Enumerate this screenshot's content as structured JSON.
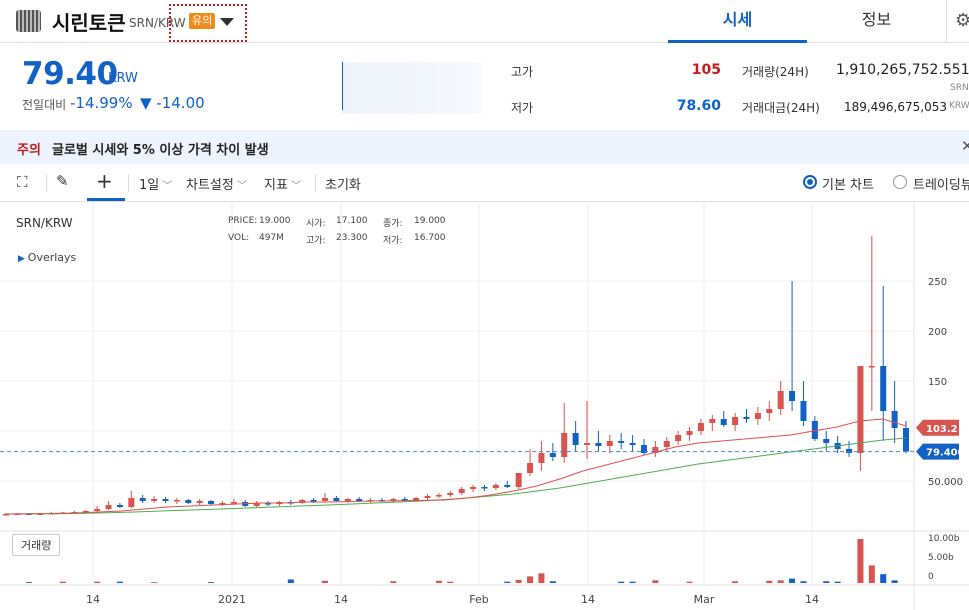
{
  "header": {
    "coin_name": "시린토큰",
    "pair": "SRN/KRW",
    "caution_badge": "유의",
    "tabs": [
      "시세",
      "정보"
    ],
    "settings_icon": "gear-icon",
    "dropdown_icon": "caret-down-icon"
  },
  "price": {
    "current": "79.40",
    "unit": "KRW",
    "change_label": "전일대비",
    "change_rate": "-14.99%",
    "change_amount": "▼ -14.00"
  },
  "stats": {
    "high_label": "고가",
    "high_value": "105",
    "low_label": "저가",
    "low_value": "78.60",
    "volume_label": "거래량(24H)",
    "volume_value": "1,910,265,752.551",
    "volume_unit": "SRN",
    "amount_label": "거래대금(24H)",
    "amount_value": "189,496,675,053",
    "amount_unit": "KRW"
  },
  "notice": {
    "tag": "주의",
    "text": "글로벌 시세와 5% 이상 가격 차이 발생"
  },
  "toolbar": {
    "interval": "1일",
    "chart_settings": "차트설정",
    "indicators": "지표",
    "reset": "초기화",
    "basic_chart": "기본 차트",
    "trading_view": "트레이딩뷰",
    "icons": [
      "fullscreen-icon",
      "pencil-icon",
      "crosshair-icon"
    ]
  },
  "chart": {
    "symbol": "SRN/KRW",
    "overlays_label": "Overlays",
    "ohlc": {
      "price_label": "PRICE:",
      "price": "19.000",
      "open_label": "시가:",
      "open": "17.100",
      "close_label": "종가:",
      "close": "19.000",
      "vol_label": "VOL:",
      "vol": "497M",
      "high_label": "고가:",
      "high": "23.300",
      "low_label": "저가:",
      "low": "16.700"
    },
    "volume_button": "거래량",
    "price_tag_high": "103.2",
    "price_tag_current": "79.400",
    "colors": {
      "up": "#d9534f",
      "down": "#1261c4",
      "ma_short": "#e05050",
      "ma_long": "#4cb050",
      "accent": "#1261c4"
    }
  },
  "chart_data": {
    "type": "candlestick",
    "x_ticks": [
      "14",
      "2021",
      "14",
      "Feb",
      "14",
      "Mar",
      "14"
    ],
    "y_ticks": [
      "250",
      "200",
      "150",
      "100",
      "50.000"
    ],
    "volume_ticks": [
      "10.00b",
      "5.00b",
      "0"
    ],
    "ylim": [
      0,
      300
    ],
    "candles": [
      [
        17,
        18,
        16,
        17
      ],
      [
        17,
        18,
        16,
        17.5
      ],
      [
        17.5,
        18,
        16.5,
        17
      ],
      [
        17,
        18,
        16,
        17.5
      ],
      [
        17.5,
        19,
        17,
        18
      ],
      [
        18,
        19,
        17,
        18.5
      ],
      [
        18.5,
        20,
        18,
        19
      ],
      [
        19,
        21,
        18,
        20
      ],
      [
        20,
        25,
        19,
        22
      ],
      [
        22,
        30,
        21,
        26
      ],
      [
        26,
        28,
        23,
        24
      ],
      [
        24,
        40,
        23,
        33
      ],
      [
        33,
        36,
        28,
        30
      ],
      [
        30,
        35,
        28,
        32
      ],
      [
        32,
        34,
        28,
        30
      ],
      [
        30,
        33,
        27,
        31
      ],
      [
        31,
        32,
        27,
        28
      ],
      [
        28,
        32,
        26,
        30
      ],
      [
        30,
        31,
        26,
        27
      ],
      [
        27,
        30,
        25,
        28
      ],
      [
        28,
        32,
        26,
        29
      ],
      [
        29,
        31,
        24,
        25
      ],
      [
        25,
        30,
        24,
        28
      ],
      [
        28,
        30,
        25,
        27
      ],
      [
        27,
        30,
        25,
        29
      ],
      [
        29,
        31,
        26,
        28
      ],
      [
        28,
        32,
        27,
        31
      ],
      [
        31,
        33,
        28,
        30
      ],
      [
        30,
        38,
        29,
        33
      ],
      [
        33,
        35,
        29,
        30
      ],
      [
        30,
        33,
        28,
        32
      ],
      [
        32,
        34,
        29,
        30
      ],
      [
        30,
        33,
        28,
        31
      ],
      [
        31,
        33,
        29,
        30
      ],
      [
        30,
        33,
        28,
        32
      ],
      [
        32,
        34,
        29,
        30
      ],
      [
        30,
        34,
        29,
        33
      ],
      [
        33,
        37,
        31,
        35
      ],
      [
        35,
        38,
        33,
        36
      ],
      [
        36,
        40,
        34,
        38
      ],
      [
        38,
        44,
        36,
        42
      ],
      [
        42,
        46,
        39,
        44
      ],
      [
        44,
        46,
        40,
        43
      ],
      [
        43,
        48,
        41,
        46
      ],
      [
        46,
        50,
        43,
        44
      ],
      [
        44,
        56,
        42,
        58
      ],
      [
        58,
        82,
        55,
        68
      ],
      [
        68,
        90,
        60,
        78
      ],
      [
        78,
        88,
        70,
        74
      ],
      [
        74,
        128,
        68,
        98
      ],
      [
        98,
        110,
        80,
        86
      ],
      [
        86,
        130,
        72,
        88
      ],
      [
        88,
        100,
        80,
        85
      ],
      [
        85,
        96,
        78,
        90
      ],
      [
        90,
        98,
        82,
        88
      ],
      [
        88,
        96,
        80,
        86
      ],
      [
        86,
        92,
        76,
        78
      ],
      [
        78,
        90,
        74,
        84
      ],
      [
        84,
        94,
        80,
        90
      ],
      [
        90,
        100,
        86,
        96
      ],
      [
        96,
        104,
        90,
        100
      ],
      [
        100,
        112,
        96,
        108
      ],
      [
        108,
        116,
        100,
        112
      ],
      [
        112,
        120,
        104,
        106
      ],
      [
        106,
        118,
        100,
        114
      ],
      [
        114,
        122,
        108,
        112
      ],
      [
        112,
        124,
        106,
        118
      ],
      [
        118,
        130,
        110,
        122
      ],
      [
        122,
        150,
        116,
        140
      ],
      [
        140,
        250,
        120,
        130
      ],
      [
        130,
        150,
        105,
        110
      ],
      [
        110,
        115,
        90,
        92
      ],
      [
        92,
        100,
        80,
        88
      ],
      [
        88,
        95,
        78,
        82
      ],
      [
        82,
        90,
        74,
        78
      ],
      [
        78,
        150,
        60,
        165
      ],
      [
        165,
        295,
        120,
        165
      ],
      [
        165,
        245,
        90,
        120
      ],
      [
        120,
        150,
        88,
        103
      ],
      [
        103,
        110,
        78,
        79.4
      ]
    ],
    "ma_short": [
      17,
      17.3,
      17.5,
      18,
      19,
      20,
      22,
      24,
      25,
      26,
      27,
      28,
      28,
      29,
      29,
      29.5,
      30,
      30.2,
      30.5,
      31,
      33,
      36,
      40,
      45,
      52,
      60,
      66,
      72,
      78,
      84,
      88,
      90,
      92,
      94,
      96,
      100,
      104,
      110,
      112,
      105
    ],
    "ma_long": [
      17,
      17.1,
      17.2,
      17.5,
      18,
      18.6,
      19.4,
      20.2,
      21,
      21.8,
      22.6,
      23.5,
      24.4,
      25.2,
      26,
      27,
      28,
      29,
      30,
      31.5,
      33,
      35,
      37,
      40,
      43,
      47,
      51,
      55,
      59,
      63,
      67,
      70,
      73,
      76,
      79,
      82,
      85,
      88,
      91,
      93
    ],
    "volume": [
      0,
      0,
      0.2,
      0,
      0,
      0.3,
      0,
      0,
      0.3,
      0,
      0.3,
      0,
      0,
      0.2,
      0,
      0,
      0,
      0,
      0.2,
      0,
      0,
      0,
      0,
      0,
      0,
      0.8,
      0,
      0,
      0.5,
      0,
      0,
      0,
      0,
      0,
      0.4,
      0,
      0,
      0,
      0.5,
      0.3,
      0,
      0,
      0,
      0,
      0.3,
      0.7,
      1.5,
      2.2,
      0.4,
      0,
      0,
      0,
      0,
      0,
      0.3,
      0.3,
      0,
      0.6,
      0,
      0,
      0.3,
      0,
      0,
      0,
      0.4,
      0,
      0,
      0.5,
      0.6,
      1.0,
      0.4,
      0,
      0.4,
      0.3,
      0,
      10.0,
      4.0,
      2.0,
      0.6,
      0
    ]
  }
}
